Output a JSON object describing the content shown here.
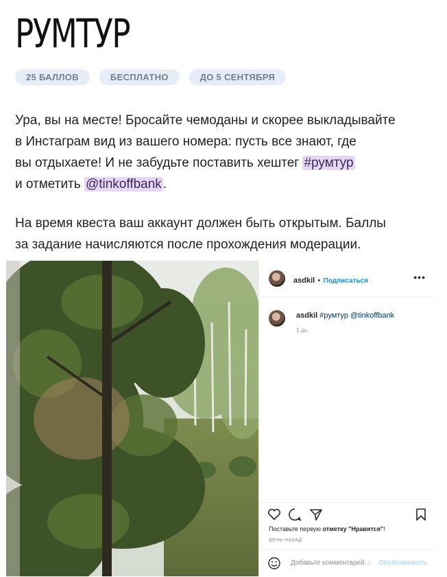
{
  "logo": "РУМТУР",
  "tags": [
    "25 БАЛЛОВ",
    "БЕСПЛАТНО",
    "ДО 5 СЕНТЯБРЯ"
  ],
  "paragraph1": {
    "line1": "Ура, вы на месте! Бросайте чемоданы и скорее выкладывайте",
    "line2": "в Инстаграм вид из вашего номера: пусть все знают, где",
    "line3_pre": "вы отдыхаете! И не забудьте поставить хештег ",
    "hashtag": "#румтур",
    "line4_pre": "и отметить ",
    "mention": "@tinkoffbank",
    "line4_post": "."
  },
  "paragraph2": {
    "line1": "На время квеста ваш аккаунт должен быть открытым. Баллы",
    "line2": "за задание начисляются после прохождения модерации."
  },
  "post": {
    "username": "asdkil",
    "separator": "•",
    "follow_label": "Подписаться",
    "more_icon": "more-dots-icon",
    "caption_user": "asdkil",
    "caption_text": "#румтур @tinkoffbank",
    "caption_age": "1 дн.",
    "likes_pre": "Поставьте первую ",
    "likes_bold": "отметку \"Нравится\"",
    "likes_post": "!",
    "time_ago": "ДЕНЬ НАЗАД",
    "comment_placeholder": "Добавьте комментарий...",
    "publish_label": "Опубликовать"
  },
  "colors": {
    "tag_bg": "#e6edf6",
    "tag_text": "#6f7f93",
    "highlight": "#e7d7f6",
    "link_blue": "#0095f6"
  }
}
